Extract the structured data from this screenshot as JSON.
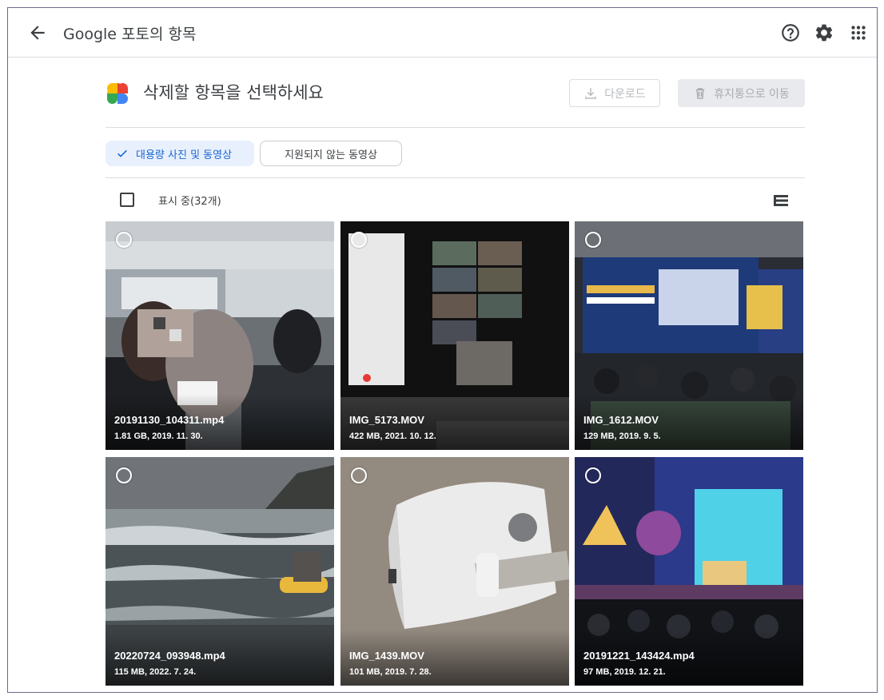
{
  "header": {
    "title": "Google 포토의 항목",
    "back_icon": "arrow-back-icon",
    "help_icon": "help-icon",
    "settings_icon": "gear-icon",
    "apps_icon": "apps-grid-icon"
  },
  "main": {
    "title": "삭제할 항목을 선택하세요",
    "download_label": "다운로드",
    "trash_label": "휴지통으로 이동",
    "chips": {
      "large_label": "대용량 사진 및 동영상",
      "unsupported_label": "지원되지 않는 동영상"
    },
    "showing_label": "표시 중(32개)"
  },
  "items": [
    {
      "filename": "20191130_104311.mp4",
      "meta": "1.81 GB, 2019. 11. 30."
    },
    {
      "filename": "IMG_5173.MOV",
      "meta": "422 MB, 2021. 10. 12."
    },
    {
      "filename": "IMG_1612.MOV",
      "meta": "129 MB, 2019. 9. 5."
    },
    {
      "filename": "20220724_093948.mp4",
      "meta": "115 MB, 2022. 7. 24."
    },
    {
      "filename": "IMG_1439.MOV",
      "meta": "101 MB, 2019. 7. 28."
    },
    {
      "filename": "20191221_143424.mp4",
      "meta": "97 MB, 2019. 12. 21."
    }
  ],
  "colors": {
    "accent": "#1967d2",
    "chip_selected_bg": "#e8f0fe",
    "divider": "#dadce0"
  }
}
